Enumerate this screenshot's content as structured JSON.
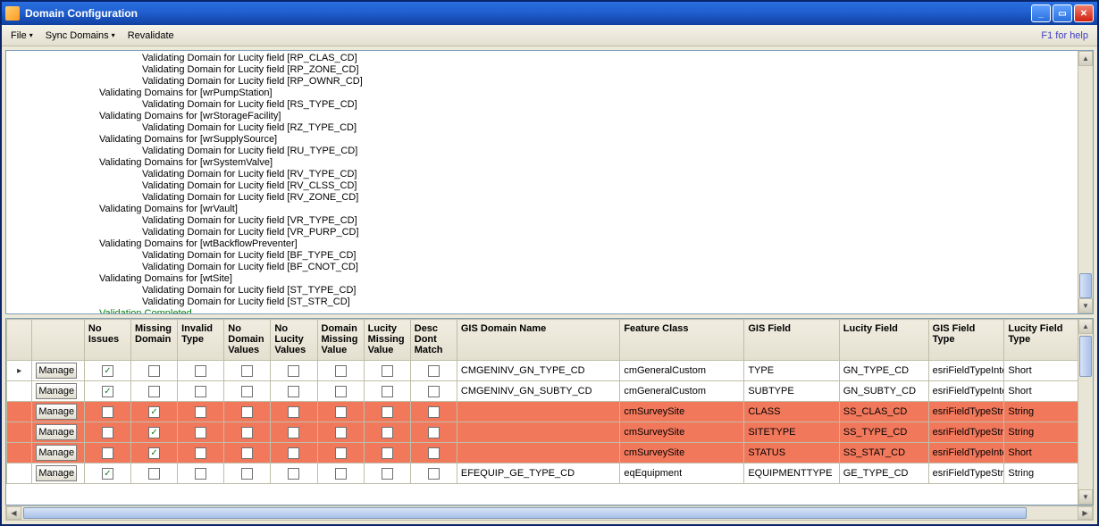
{
  "window": {
    "title": "Domain Configuration"
  },
  "menubar": {
    "file": "File",
    "sync": "Sync Domains",
    "revalidate": "Revalidate",
    "help": "F1 for help"
  },
  "log": {
    "lines": [
      {
        "cls": "i2",
        "text": "Validating Domain for Lucity field [RP_CLAS_CD]"
      },
      {
        "cls": "i2",
        "text": "Validating Domain for Lucity field [RP_ZONE_CD]"
      },
      {
        "cls": "i2",
        "text": "Validating Domain for Lucity field [RP_OWNR_CD]"
      },
      {
        "cls": "i1",
        "text": "Validating Domains for [wrPumpStation]"
      },
      {
        "cls": "i2",
        "text": "Validating Domain for Lucity field [RS_TYPE_CD]"
      },
      {
        "cls": "i1",
        "text": "Validating Domains for [wrStorageFacility]"
      },
      {
        "cls": "i2",
        "text": "Validating Domain for Lucity field [RZ_TYPE_CD]"
      },
      {
        "cls": "i1",
        "text": "Validating Domains for [wrSupplySource]"
      },
      {
        "cls": "i2",
        "text": "Validating Domain for Lucity field [RU_TYPE_CD]"
      },
      {
        "cls": "i1",
        "text": "Validating Domains for [wrSystemValve]"
      },
      {
        "cls": "i2",
        "text": "Validating Domain for Lucity field [RV_TYPE_CD]"
      },
      {
        "cls": "i2",
        "text": "Validating Domain for Lucity field [RV_CLSS_CD]"
      },
      {
        "cls": "i2",
        "text": "Validating Domain for Lucity field [RV_ZONE_CD]"
      },
      {
        "cls": "i1",
        "text": "Validating Domains for [wrVault]"
      },
      {
        "cls": "i2",
        "text": "Validating Domain for Lucity field [VR_TYPE_CD]"
      },
      {
        "cls": "i2",
        "text": "Validating Domain for Lucity field [VR_PURP_CD]"
      },
      {
        "cls": "i1",
        "text": "Validating Domains for [wtBackflowPreventer]"
      },
      {
        "cls": "i2",
        "text": "Validating Domain for Lucity field [BF_TYPE_CD]"
      },
      {
        "cls": "i2",
        "text": "Validating Domain for Lucity field [BF_CNOT_CD]"
      },
      {
        "cls": "i1",
        "text": "Validating Domains for [wtSite]"
      },
      {
        "cls": "i2",
        "text": "Validating Domain for Lucity field [ST_TYPE_CD]"
      },
      {
        "cls": "i2",
        "text": "Validating Domain for Lucity field [ST_STR_CD]"
      }
    ],
    "completed": "Validation Completed"
  },
  "grid": {
    "headers": {
      "no_issues": "No\nIssues",
      "missing_domain": "Missing\nDomain",
      "invalid_type": "Invalid\nType",
      "no_domain_values": "No\nDomain\nValues",
      "no_lucity_values": "No\nLucity\nValues",
      "domain_missing_value": "Domain\nMissing\nValue",
      "lucity_missing_value": "Lucity\nMissing\nValue",
      "desc_dont_match": "Desc\nDont\nMatch",
      "gis_domain_name": "GIS Domain Name",
      "feature_class": "Feature Class",
      "gis_field": "GIS Field",
      "lucity_field": "Lucity Field",
      "gis_field_type": "GIS Field\nType",
      "lucity_field_type": "Lucity Field\nType"
    },
    "manage_label": "Manage",
    "rows": [
      {
        "sel": true,
        "red": false,
        "no_issues": true,
        "missing": false,
        "invalid": false,
        "ndv": false,
        "nlv": false,
        "dmv": false,
        "lmv": false,
        "ddm": false,
        "domain": "CMGENINV_GN_TYPE_CD",
        "feat": "cmGeneralCustom",
        "gfield": "TYPE",
        "lfield": "GN_TYPE_CD",
        "gtype": "esriFieldTypeInte...",
        "ltype": "Short"
      },
      {
        "sel": false,
        "red": false,
        "no_issues": true,
        "missing": false,
        "invalid": false,
        "ndv": false,
        "nlv": false,
        "dmv": false,
        "lmv": false,
        "ddm": false,
        "domain": "CMGENINV_GN_SUBTY_CD",
        "feat": "cmGeneralCustom",
        "gfield": "SUBTYPE",
        "lfield": "GN_SUBTY_CD",
        "gtype": "esriFieldTypeInte...",
        "ltype": "Short"
      },
      {
        "sel": false,
        "red": true,
        "no_issues": false,
        "missing": true,
        "invalid": false,
        "ndv": false,
        "nlv": false,
        "dmv": false,
        "lmv": false,
        "ddm": false,
        "domain": "",
        "feat": "cmSurveySite",
        "gfield": "CLASS",
        "lfield": "SS_CLAS_CD",
        "gtype": "esriFieldTypeString",
        "ltype": "String"
      },
      {
        "sel": false,
        "red": true,
        "no_issues": false,
        "missing": true,
        "invalid": false,
        "ndv": false,
        "nlv": false,
        "dmv": false,
        "lmv": false,
        "ddm": false,
        "domain": "",
        "feat": "cmSurveySite",
        "gfield": "SITETYPE",
        "lfield": "SS_TYPE_CD",
        "gtype": "esriFieldTypeString",
        "ltype": "String"
      },
      {
        "sel": false,
        "red": true,
        "no_issues": false,
        "missing": true,
        "invalid": false,
        "ndv": false,
        "nlv": false,
        "dmv": false,
        "lmv": false,
        "ddm": false,
        "domain": "",
        "feat": "cmSurveySite",
        "gfield": "STATUS",
        "lfield": "SS_STAT_CD",
        "gtype": "esriFieldTypeInte...",
        "ltype": "Short"
      },
      {
        "sel": false,
        "red": false,
        "no_issues": true,
        "missing": false,
        "invalid": false,
        "ndv": false,
        "nlv": false,
        "dmv": false,
        "lmv": false,
        "ddm": false,
        "domain": "EFEQUIP_GE_TYPE_CD",
        "feat": "eqEquipment",
        "gfield": "EQUIPMENTTYPE",
        "lfield": "GE_TYPE_CD",
        "gtype": "esriFieldTypeString",
        "ltype": "String"
      }
    ]
  }
}
